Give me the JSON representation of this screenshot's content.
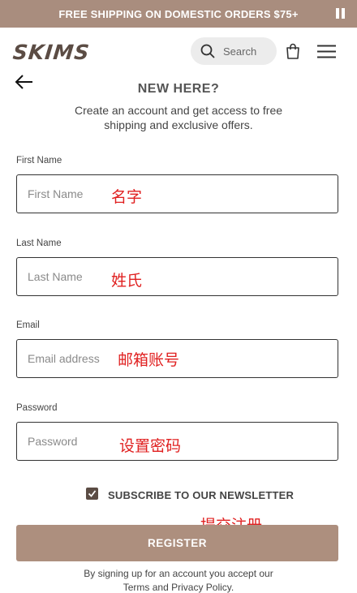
{
  "promo": {
    "text": "FREE SHIPPING ON DOMESTIC ORDERS $75+"
  },
  "header": {
    "logo": "SKIMS",
    "search_label": "Search"
  },
  "signup": {
    "title": "NEW HERE?",
    "subtitle": "Create an account and get access to free shipping and exclusive offers.",
    "fields": [
      {
        "label": "First Name",
        "placeholder": "First Name",
        "value": "",
        "annotation": "名字"
      },
      {
        "label": "Last Name",
        "placeholder": "Last Name",
        "value": "",
        "annotation": "姓氏"
      },
      {
        "label": "Email",
        "placeholder": "Email address",
        "value": "",
        "annotation": "邮箱账号"
      },
      {
        "label": "Password",
        "placeholder": "Password",
        "value": "",
        "annotation": "设置密码"
      }
    ],
    "newsletter": {
      "label": "SUBSCRIBE TO OUR NEWSLETTER",
      "checked": true
    },
    "register_annotation": "提交注册",
    "register_label": "REGISTER",
    "terms_prefix": "By signing up for an account you accept our ",
    "terms_link": "Terms",
    "terms_and": " and ",
    "privacy_link": "Privacy Policy",
    "terms_suffix": "."
  },
  "icons": [
    "pause-icon",
    "search-icon",
    "bag-icon",
    "menu-icon",
    "back-arrow-icon",
    "checkmark-icon"
  ],
  "colors": {
    "brand": "#a98d7e",
    "button": "#ad8f7e",
    "annotation": "#e02020",
    "checkbox": "#5b4c44"
  }
}
